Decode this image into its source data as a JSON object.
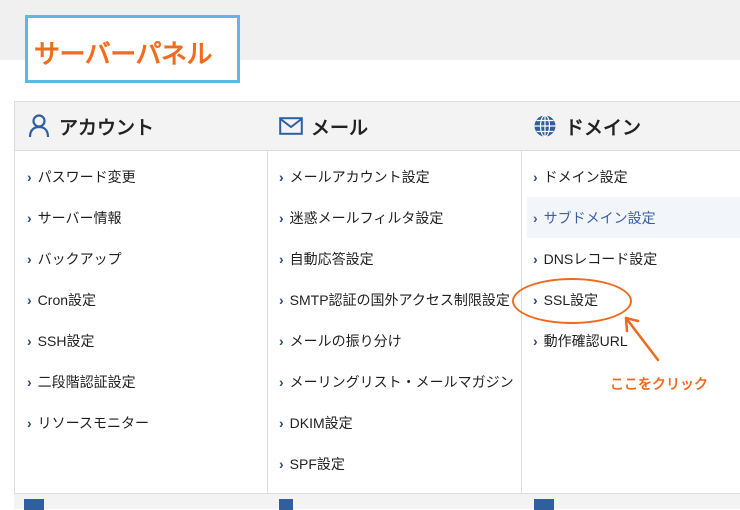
{
  "header": {
    "title": "サーバーパネル"
  },
  "columns": [
    {
      "heading": "アカウント",
      "icon": "user-icon",
      "items": [
        "パスワード変更",
        "サーバー情報",
        "バックアップ",
        "Cron設定",
        "SSH設定",
        "二段階認証設定",
        "リソースモニター"
      ]
    },
    {
      "heading": "メール",
      "icon": "mail-icon",
      "items": [
        "メールアカウント設定",
        "迷惑メールフィルタ設定",
        "自動応答設定",
        "SMTP認証の国外アクセス制限設定",
        "メールの振り分け",
        "メーリングリスト・メールマガジン",
        "DKIM設定",
        "SPF設定"
      ]
    },
    {
      "heading": "ドメイン",
      "icon": "globe-icon",
      "items": [
        "ドメイン設定",
        "サブドメイン設定",
        "DNSレコード設定",
        "SSL設定",
        "動作確認URL"
      ]
    }
  ],
  "annotation": {
    "text": "ここをクリック",
    "color": "#ee6a1f",
    "target": "SSL設定"
  },
  "colors": {
    "accent": "#f26b1d",
    "title_border": "#5fb8e4",
    "icon_blue": "#2f5fa0",
    "link_highlight": "#3c5ea3"
  }
}
